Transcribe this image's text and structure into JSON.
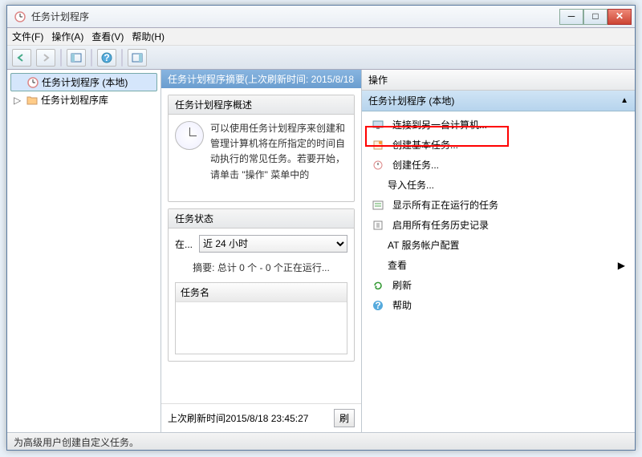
{
  "window": {
    "title": "任务计划程序"
  },
  "menu": {
    "file": "文件(F)",
    "action": "操作(A)",
    "view": "查看(V)",
    "help": "帮助(H)"
  },
  "tree": {
    "root": "任务计划程序 (本地)",
    "lib": "任务计划程序库"
  },
  "mid": {
    "header": "任务计划程序摘要(上次刷新时间: 2015/8/18",
    "panel1_title": "任务计划程序概述",
    "overview_text": "可以使用任务计划程序来创建和管理计算机将在所指定的时间自动执行的常见任务。若要开始，请单击 \"操作\" 菜单中的",
    "panel2_title": "任务状态",
    "status_label": "在...",
    "status_select": "近 24 小时",
    "summary": "摘要: 总计 0 个 - 0 个正在运行...",
    "list_header": "任务名",
    "footer_time": "上次刷新时间2015/8/18 23:45:27",
    "refresh_btn": "刷"
  },
  "actions": {
    "header": "操作",
    "subheader": "任务计划程序 (本地)",
    "items": {
      "connect": "连接到另一台计算机...",
      "create_basic": "创建基本任务...",
      "create": "创建任务...",
      "import": "导入任务...",
      "show_running": "显示所有正在运行的任务",
      "enable_history": "启用所有任务历史记录",
      "at_config": "AT 服务帐户配置",
      "view": "查看",
      "refresh": "刷新",
      "help": "帮助"
    }
  },
  "statusbar": "为高级用户创建自定义任务。"
}
